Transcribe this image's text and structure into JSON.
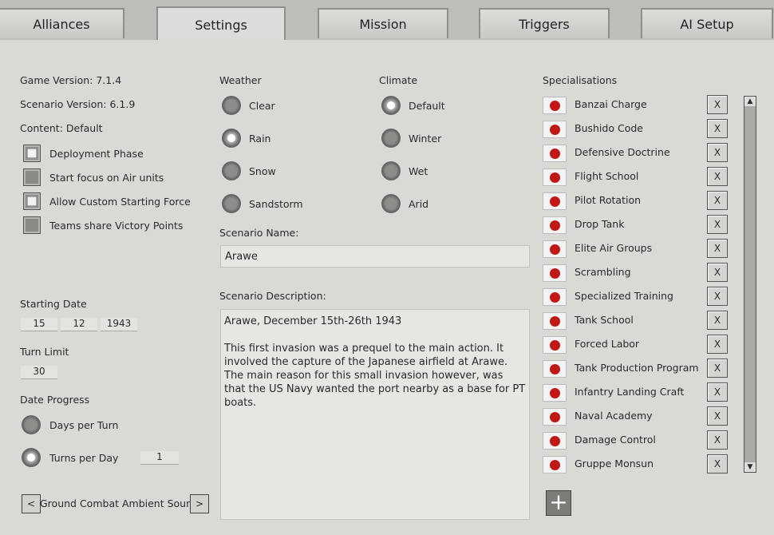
{
  "tabs": [
    "Alliances",
    "Settings",
    "Mission",
    "Triggers",
    "AI Setup"
  ],
  "info": {
    "game_version": "Game Version: 7.1.4",
    "scenario_version": "Scenario Version: 6.1.9",
    "content": "Content: Default"
  },
  "options": [
    {
      "label": "Deployment Phase",
      "checked": true
    },
    {
      "label": "Start focus on Air units",
      "checked": false
    },
    {
      "label": "Allow Custom Starting Force",
      "checked": true
    },
    {
      "label": "Teams share Victory Points",
      "checked": false
    }
  ],
  "starting_date": {
    "label": "Starting Date",
    "day": "15",
    "month": "12",
    "year": "1943"
  },
  "turn_limit": {
    "label": "Turn Limit",
    "value": "30"
  },
  "date_progress": {
    "label": "Date Progress",
    "days_per_turn": "Days per Turn",
    "turns_per_day": "Turns per Day",
    "turns_value": "1",
    "selected": "Turns per Day"
  },
  "sound": {
    "prev": "<",
    "label": "Ground Combat Ambient Sound",
    "next": ">"
  },
  "weather": {
    "label": "Weather",
    "options": [
      "Clear",
      "Rain",
      "Snow",
      "Sandstorm"
    ],
    "selected": "Rain"
  },
  "climate": {
    "label": "Climate",
    "options": [
      "Default",
      "Winter",
      "Wet",
      "Arid"
    ],
    "selected": "Default"
  },
  "scenario": {
    "name_label": "Scenario Name:",
    "name": "Arawe",
    "desc_label": "Scenario Description:",
    "desc_line1": "Arawe, December 15th-26th 1943",
    "desc_body": "This first invasion was a prequel to the main action.  It involved the capture of the Japanese airfield at Arawe. The main reason for this small invasion however, was that the US Navy wanted the port nearby as a base for PT boats."
  },
  "specialisations": {
    "label": "Specialisations",
    "remove_label": "X",
    "items": [
      "Banzai Charge",
      "Bushido Code",
      "Defensive Doctrine",
      "Flight School",
      "Pilot Rotation",
      "Drop Tank",
      "Elite Air Groups",
      "Scrambling",
      "Specialized Training",
      "Tank School",
      "Forced Labor",
      "Tank Production Program",
      "Infantry Landing Craft",
      "Naval Academy",
      "Damage Control",
      "Gruppe Monsun"
    ],
    "flag_icon": "japan-flag-icon",
    "add_label": "+"
  },
  "colors": {
    "flag_red": "#c21717",
    "panel": "#d9d9d6"
  }
}
